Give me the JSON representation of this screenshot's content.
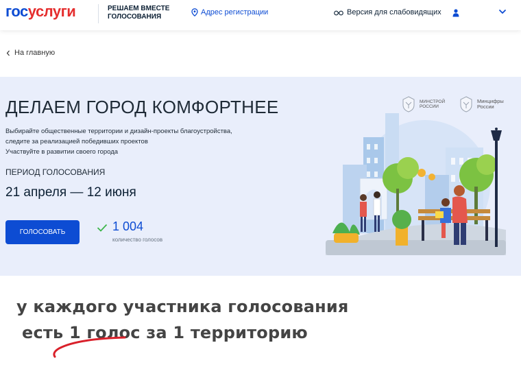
{
  "header": {
    "logo_part1": "гос",
    "logo_part2": "услуги",
    "project_line1": "Решаем вместе",
    "project_line2": "голосования",
    "address_label": "Адрес регистрации",
    "accessibility_label": "Версия для слабовидящих",
    "icons": [
      "location-pin-icon",
      "glasses-icon",
      "user-icon",
      "chevron-down-icon"
    ]
  },
  "nav": {
    "back_label": "На главную"
  },
  "banner": {
    "title": "Делаем город комфортнее",
    "description_lines": [
      "Выбирайте общественные территории и дизайн-проекты благоустройства,",
      "следите за реализацией победивших проектов",
      "Участвуйте в развитии своего города"
    ],
    "period_label": "Период голосования",
    "period_value": "21 апреля — 12 июня",
    "vote_button": "Голосовать",
    "votes_count": "1 004",
    "votes_label": "количество голосов",
    "ministry1_line1": "Минстрой",
    "ministry1_line2": "России",
    "ministry2_line1": "Минцифры",
    "ministry2_line2": "России"
  },
  "annotation": {
    "line1": "у каждого участника голосования",
    "line2": "есть 1 голос за 1 территорию"
  },
  "colors": {
    "brand_blue": "#0d4cd3",
    "brand_red": "#e52e2e",
    "banner_bg": "#e9eefb",
    "check_green": "#3db54a",
    "annotation_red": "#d9202a"
  }
}
